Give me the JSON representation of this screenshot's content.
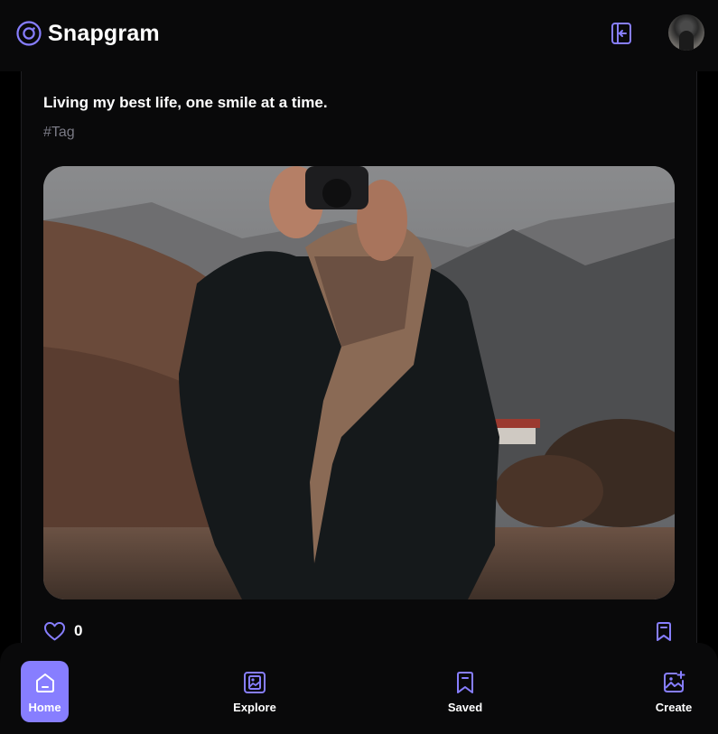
{
  "app": {
    "name": "Snapgram",
    "accent_color": "#877eff",
    "logo_icon": "snapgram-logo-icon",
    "logout_icon": "logout-icon",
    "avatar_icon": "user-avatar"
  },
  "post": {
    "caption": "Living my best life, one smile at a time.",
    "tags": [
      "#Tag"
    ],
    "image_description_icon": "post-photo",
    "likes_count": "0",
    "like_icon": "heart-icon",
    "save_icon": "bookmark-icon"
  },
  "bottom_nav": {
    "items": [
      {
        "label": "Home",
        "icon": "home-icon",
        "active": true
      },
      {
        "label": "Explore",
        "icon": "gallery-icon",
        "active": false
      },
      {
        "label": "Saved",
        "icon": "bookmark-icon",
        "active": false
      },
      {
        "label": "Create",
        "icon": "add-image-icon",
        "active": false
      }
    ]
  }
}
